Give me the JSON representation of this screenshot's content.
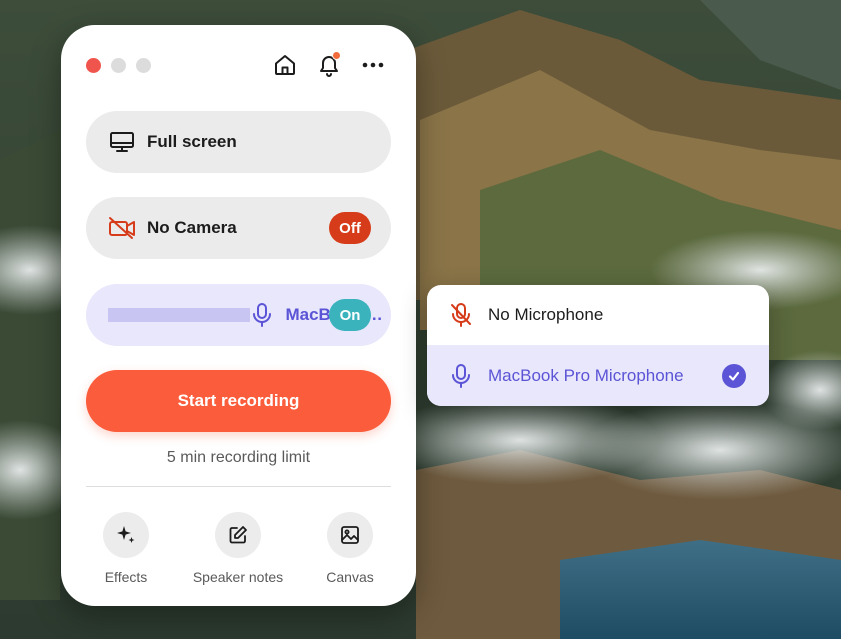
{
  "colors": {
    "accent_red": "#fb5c3b",
    "accent_purple": "#5b54d6",
    "toggle_off": "#d63c1a",
    "toggle_on": "#3ab3bd",
    "pill_gray": "#ebebeb",
    "pill_selected": "#e9e7fb"
  },
  "window": {
    "controls": [
      "close",
      "minimize",
      "zoom"
    ],
    "icons": [
      "home-icon",
      "bell-icon",
      "more-icon"
    ]
  },
  "sources": {
    "screen": {
      "label": "Full screen",
      "icon": "monitor-icon"
    },
    "camera": {
      "label": "No Camera",
      "icon": "camera-off-icon",
      "toggle": "Off"
    },
    "microphone": {
      "label": "MacBook Pro Microphone",
      "icon": "microphone-icon",
      "toggle": "On",
      "level": 0.22
    }
  },
  "actions": {
    "start_label": "Start recording",
    "limit_text": "5 min recording limit"
  },
  "tools": [
    {
      "label": "Effects",
      "icon": "sparkles-icon"
    },
    {
      "label": "Speaker notes",
      "icon": "edit-note-icon"
    },
    {
      "label": "Canvas",
      "icon": "image-icon"
    }
  ],
  "mic_dropdown": {
    "items": [
      {
        "label": "No Microphone",
        "icon": "microphone-off-icon",
        "selected": false
      },
      {
        "label": "MacBook Pro Microphone",
        "icon": "microphone-icon",
        "selected": true
      }
    ]
  }
}
